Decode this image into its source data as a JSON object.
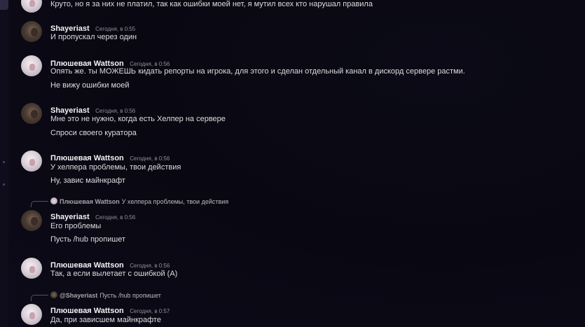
{
  "messages": [
    {
      "id": "m0",
      "lines": [
        "Круто, но я за них не платил, так как ошибки моей нет, я мутил всех кто нарушал правила"
      ]
    },
    {
      "id": "m1",
      "author": "Shayeriast",
      "time": "Сегодня, в 0:55",
      "lines": [
        "И пропускал через один"
      ]
    },
    {
      "id": "m2",
      "author": "Плюшевая Wattson",
      "time": "Сегодня, в 0:56",
      "lines": [
        "Опять же. ты МОЖЕШЬ кидать репорты на игрока, для этого и сделан отдельный канал в дискорд сервере растми.",
        "Не вижу ошибки моей"
      ]
    },
    {
      "id": "m3",
      "author": "Shayeriast",
      "time": "Сегодня, в 0:56",
      "lines": [
        "Мне это не нужно, когда есть Хелпер на сервере",
        "Спроси своего куратора"
      ]
    },
    {
      "id": "m4",
      "author": "Плюшевая Wattson",
      "time": "Сегодня, в 0:56",
      "lines": [
        "У хелпера проблемы, твои действия",
        "Ну, завис майнкрафт"
      ]
    },
    {
      "id": "m5",
      "reply": {
        "author": "Плюшевая Wattson",
        "text": "У хелпера проблемы, твои действия"
      },
      "author": "Shayeriast",
      "time": "Сегодня, в 0:56",
      "lines": [
        "Его проблемы",
        "Пусть /hub пропишет"
      ]
    },
    {
      "id": "m6",
      "author": "Плюшевая Wattson",
      "time": "Сегодня, в 0:56",
      "lines": [
        "Так, а если вылетает с ошибкой (А)"
      ]
    },
    {
      "id": "m7",
      "reply": {
        "author": "@Shayeriast",
        "text": "Пусть /hub пропишет"
      },
      "author": "Плюшевая Wattson",
      "time": "Сегодня, в 0:57",
      "lines": [
        "Да, при зависшем майнкрафте"
      ]
    }
  ],
  "icons": {
    "dark_avatar": "avatar-dark-icon",
    "light_avatar": "avatar-light-icon"
  }
}
